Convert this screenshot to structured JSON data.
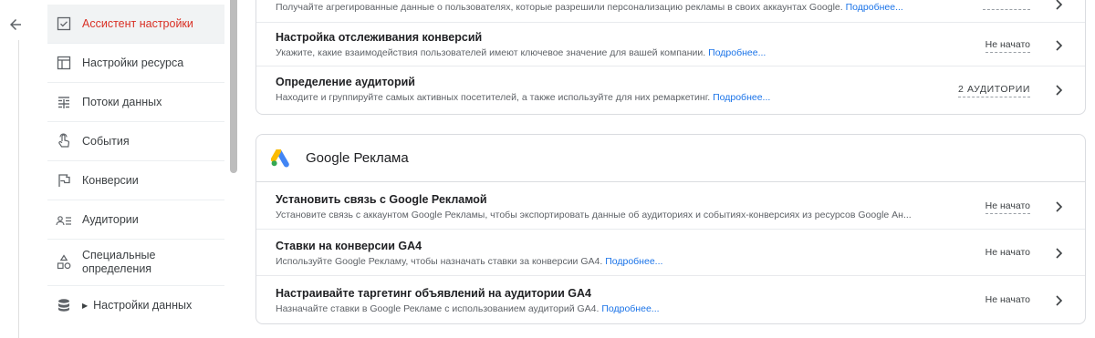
{
  "sidebar": {
    "items": [
      {
        "label": "Ассистент настройки",
        "icon": "checkbox-icon",
        "active": true
      },
      {
        "label": "Настройки ресурса",
        "icon": "property-icon"
      },
      {
        "label": "Потоки данных",
        "icon": "data-streams-icon"
      },
      {
        "label": "События",
        "icon": "touch-icon"
      },
      {
        "label": "Конверсии",
        "icon": "flag-icon"
      },
      {
        "label": "Аудитории",
        "icon": "audience-icon"
      },
      {
        "label": "Специальные определения",
        "icon": "shapes-icon"
      },
      {
        "label": "Настройки данных",
        "icon": "database-icon"
      }
    ]
  },
  "top_card": {
    "rows": [
      {
        "title": "",
        "desc": "Получайте агрегированные данные о пользователях, которые разрешили персонализацию рекламы в своих аккаунтах Google.",
        "link": "Подробнее...",
        "status": ""
      },
      {
        "title": "Настройка отслеживания конверсий",
        "desc": "Укажите, какие взаимодействия пользователей имеют ключевое значение для вашей компании.",
        "link": "Подробнее...",
        "status": "Не начато"
      },
      {
        "title": "Определение аудиторий",
        "desc": "Находите и группируйте самых активных посетителей, а также используйте для них ремаркетинг.",
        "link": "Подробнее...",
        "status": "2 АУДИТОРИИ"
      }
    ]
  },
  "ads_card": {
    "title": "Google Реклама",
    "rows": [
      {
        "title": "Установить связь с Google Рекламой",
        "desc": "Установите связь с аккаунтом Google Рекламы, чтобы экспортировать данные об аудиториях и событиях-конверсиях из ресурсов Google Ан...",
        "link": "",
        "status": "Не начато"
      },
      {
        "title": "Ставки на конверсии GA4",
        "desc": "Используйте Google Рекламу, чтобы назначать ставки за конверсии GA4.",
        "link": "Подробнее...",
        "status": "Не начато"
      },
      {
        "title": "Настраивайте таргетинг объявлений на аудитории GA4",
        "desc": "Назначайте ставки в Google Рекламе с использованием аудиторий GA4.",
        "link": "Подробнее...",
        "status": "Не начато"
      }
    ]
  },
  "colors": {
    "accent_red": "#d93025",
    "link_blue": "#1a73e8",
    "ads_yellow": "#fbbc04",
    "ads_blue": "#4285f4",
    "ads_green": "#34a853"
  }
}
